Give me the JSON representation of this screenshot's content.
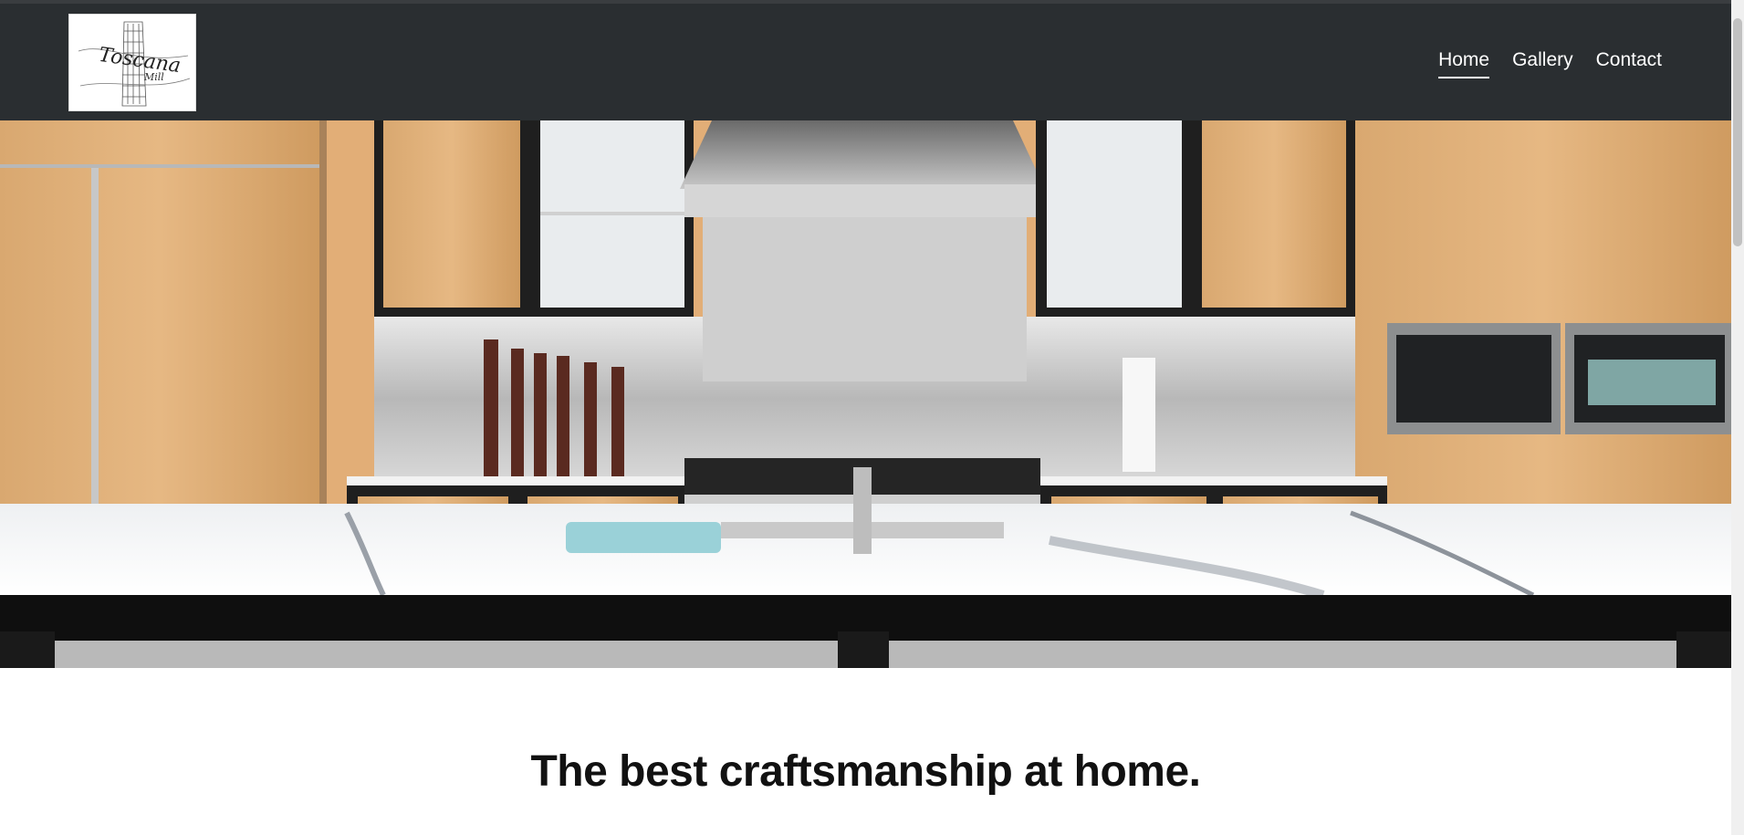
{
  "nav": {
    "items": [
      {
        "label": "Home",
        "active": true
      },
      {
        "label": "Gallery",
        "active": false
      },
      {
        "label": "Contact",
        "active": false
      }
    ]
  },
  "logo": {
    "script_text": "Toscana",
    "sub_text": "Mill"
  },
  "hero": {
    "alt": "Modern kitchen with wood cabinets and marble island"
  },
  "main": {
    "headline": "The best craftsmanship at home."
  },
  "colors": {
    "header_bg": "#2a2e31",
    "nav_text": "#ffffff",
    "headline": "#111111"
  }
}
